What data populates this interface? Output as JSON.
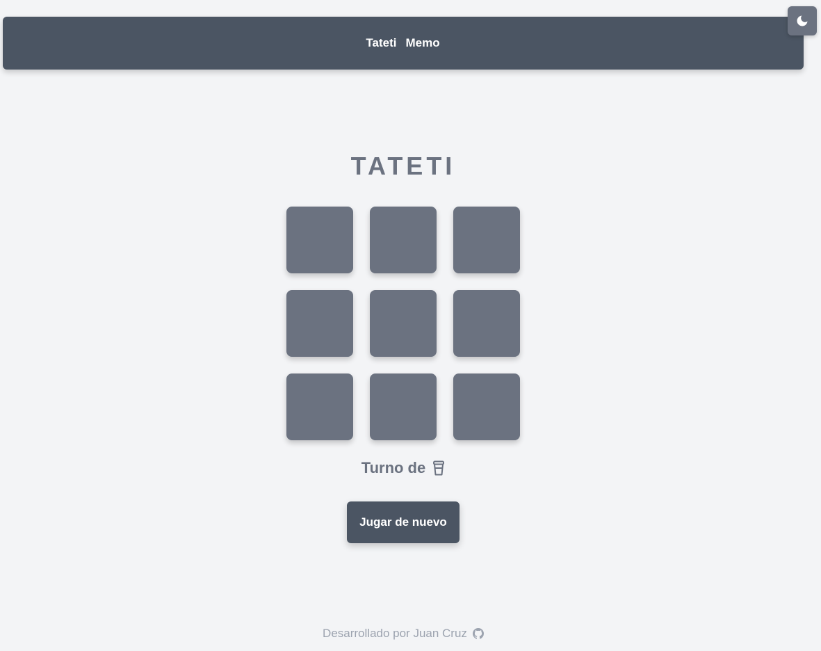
{
  "nav": {
    "links": [
      {
        "label": "Tateti"
      },
      {
        "label": "Memo"
      }
    ]
  },
  "theme_toggle": {
    "icon": "moon-icon"
  },
  "game": {
    "title": "TATETI",
    "cells": [
      "",
      "",
      "",
      "",
      "",
      "",
      "",
      "",
      ""
    ],
    "turn_label": "Turno de",
    "turn_icon": "cup-icon",
    "replay_label": "Jugar de nuevo"
  },
  "footer": {
    "text": "Desarrollado por Juan Cruz",
    "icon": "github-icon"
  },
  "colors": {
    "background": "#f3f4f6",
    "navbar": "#4b5563",
    "cell": "#6b7280",
    "title": "#6b7280",
    "footer_text": "#9ca3af"
  }
}
